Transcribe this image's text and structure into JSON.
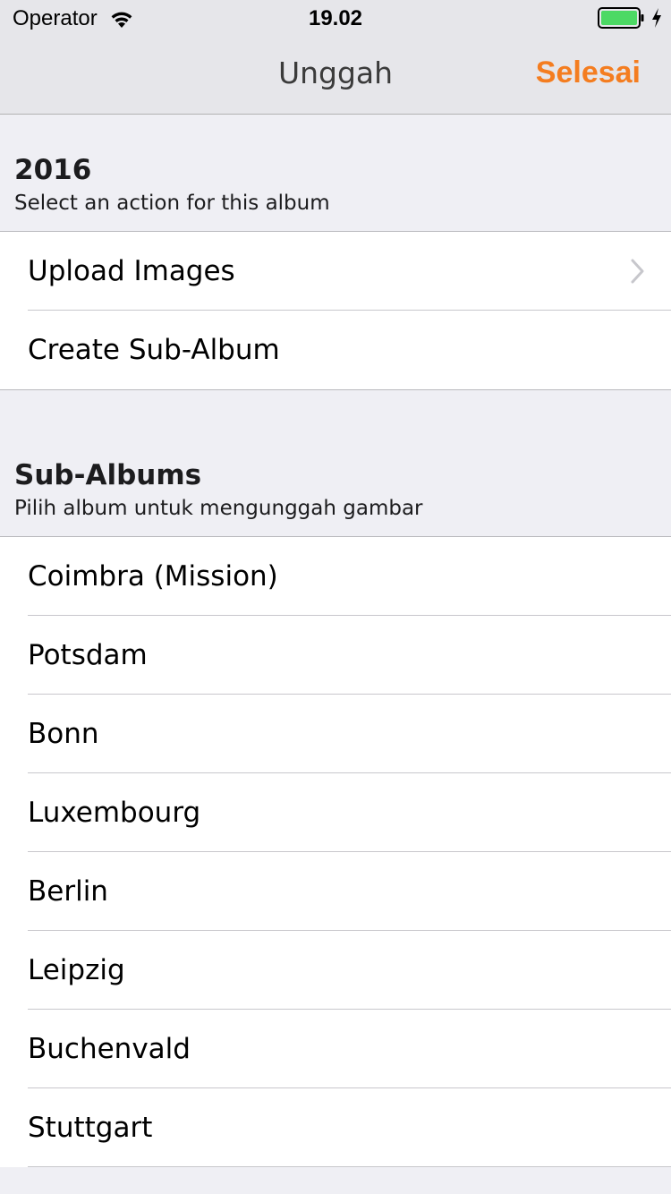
{
  "status_bar": {
    "carrier": "Operator",
    "time": "19.02",
    "icons": [
      "wifi-icon",
      "battery-icon",
      "charging-icon"
    ],
    "battery_color": "#4cd964"
  },
  "nav": {
    "title": "Unggah",
    "done_label": "Selesai",
    "accent_color": "#f47d20"
  },
  "album_section": {
    "title": "2016",
    "subtitle": "Select an action for this album",
    "actions": [
      {
        "label": "Upload Images",
        "icon": "chevron-right-icon"
      },
      {
        "label": "Create Sub-Album"
      }
    ]
  },
  "sub_albums_section": {
    "title": "Sub-Albums",
    "subtitle": "Pilih album untuk mengunggah gambar",
    "items": [
      {
        "label": "Coimbra (Mission)"
      },
      {
        "label": "Potsdam"
      },
      {
        "label": "Bonn"
      },
      {
        "label": "Luxembourg"
      },
      {
        "label": "Berlin"
      },
      {
        "label": "Leipzig"
      },
      {
        "label": "Buchenvald"
      },
      {
        "label": "Stuttgart"
      }
    ]
  }
}
